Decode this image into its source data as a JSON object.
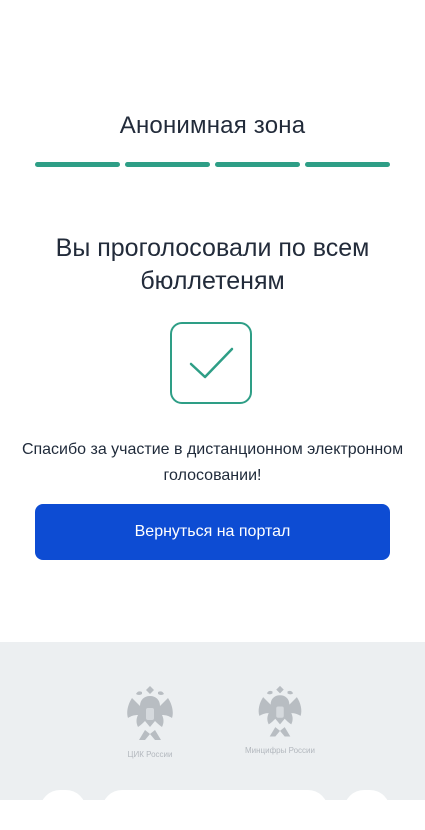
{
  "zone": {
    "title": "Анонимная зона",
    "progress_steps": 4,
    "progress_completed": 4,
    "progress_color": "#2e9e86"
  },
  "result": {
    "headline": "Вы проголосовали по всем бюллетеням",
    "icon": "checkmark-icon",
    "thanks_text": "Спасибо за участие в дистанционном электронном голосовании!"
  },
  "actions": {
    "return_label": "Вернуться на портал",
    "return_color": "#0d4cd3"
  },
  "footer": {
    "background": "#eceff1",
    "emblems": [
      {
        "icon": "cik-emblem-icon",
        "label": "ЦИК России"
      },
      {
        "icon": "mintsifry-emblem-icon",
        "label": "Минцифры России"
      }
    ]
  }
}
